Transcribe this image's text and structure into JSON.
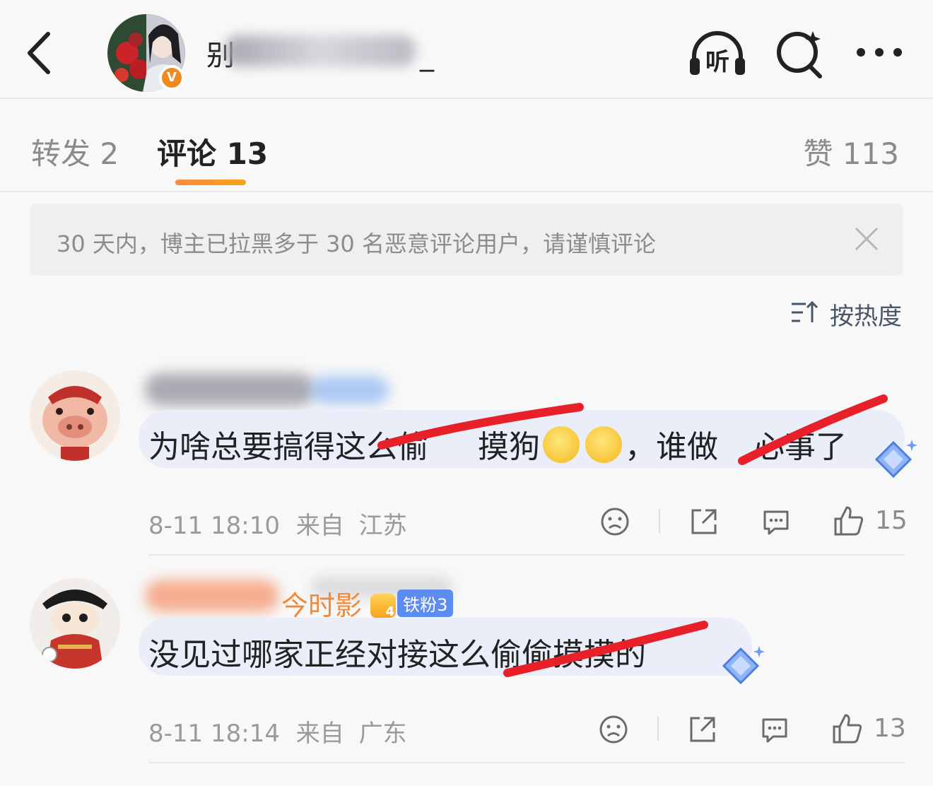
{
  "header": {
    "author_name_visible": "别",
    "author_name_tail": "_",
    "listen_label": "听",
    "icons": [
      "back-arrow-icon",
      "headphones-listen-icon",
      "search-sparkle-icon",
      "more-dots-icon"
    ],
    "verified_badge": "V"
  },
  "tabs": {
    "repost_label": "转发 2",
    "comments_label": "评论 13",
    "likes_label": "赞 113"
  },
  "notice": {
    "text": "30 天内，博主已拉黑多于 30 名恶意评论用户，请谨慎评论"
  },
  "sort": {
    "label": "按热度"
  },
  "comments": [
    {
      "text_part1": "为啥总要搞得这么偷",
      "text_part2": "摸狗",
      "text_part3": "，谁做",
      "text_part4": "心事了",
      "time": "8-11 18:10",
      "from_label": "来自",
      "location": "江苏",
      "likes": "15"
    },
    {
      "name_visible": "今时影",
      "fan_level": "4",
      "fan_badge": "铁粉3",
      "text": "没见过哪家正经对接这么偷偷摸摸的",
      "time": "8-11 18:14",
      "from_label": "来自",
      "location": "广东",
      "likes": "13"
    }
  ],
  "colors": {
    "accent_orange": "#f7931e",
    "strike_red": "#e8202a",
    "bubble_blue": "#e9eef8",
    "fan_badge_blue": "#5d8cf0"
  }
}
